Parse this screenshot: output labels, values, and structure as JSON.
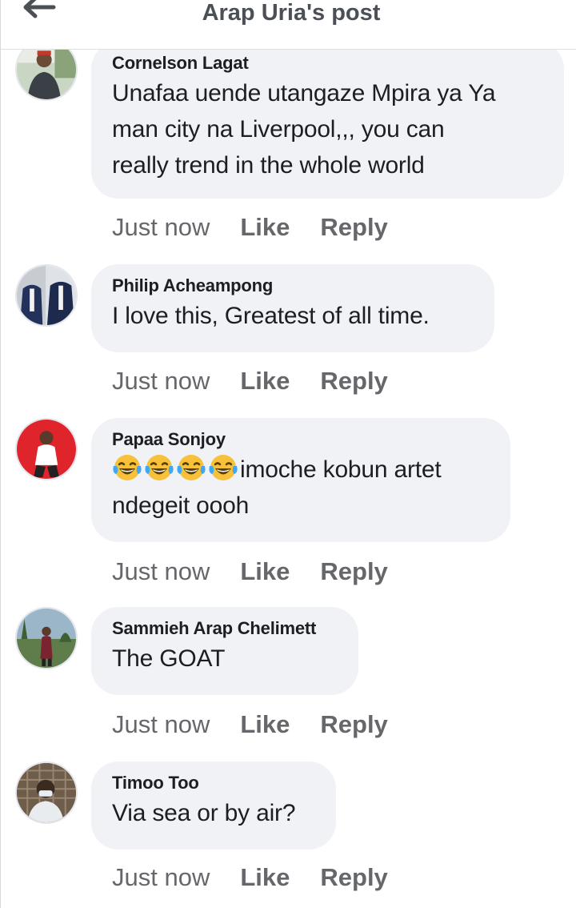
{
  "header": {
    "title": "Arap Uria's post",
    "back_icon": "arrow-left-icon"
  },
  "comments": [
    {
      "author": "Cornelson Lagat",
      "text_lines": [
        "Unafaa uende utangaze Mpira ya Ya",
        "man city na Liverpool,,, you can",
        "really trend in the whole world"
      ],
      "time": "Just now",
      "like": "Like",
      "reply": "Reply"
    },
    {
      "author": "Philip Acheampong",
      "text_lines": [
        "I love this, Greatest of all time."
      ],
      "time": "Just now",
      "like": "Like",
      "reply": "Reply"
    },
    {
      "author": "Papaa Sonjoy",
      "text_lines": [
        "imoche kobun artet",
        "ndegeit oooh"
      ],
      "emoji": "face-with-tears-of-joy",
      "emoji_count": 4,
      "time": "Just now",
      "like": "Like",
      "reply": "Reply"
    },
    {
      "author": "Sammieh Arap Chelimett",
      "text_lines": [
        "The GOAT"
      ],
      "time": "Just now",
      "like": "Like",
      "reply": "Reply"
    },
    {
      "author": "Timoo Too",
      "text_lines": [
        "Via sea or by air?"
      ],
      "time": "Just now",
      "like": "Like",
      "reply": "Reply"
    }
  ],
  "colors": {
    "bubble_bg": "#f0f2f5",
    "meta_text": "#65676b",
    "title_text": "#4b4f56"
  }
}
